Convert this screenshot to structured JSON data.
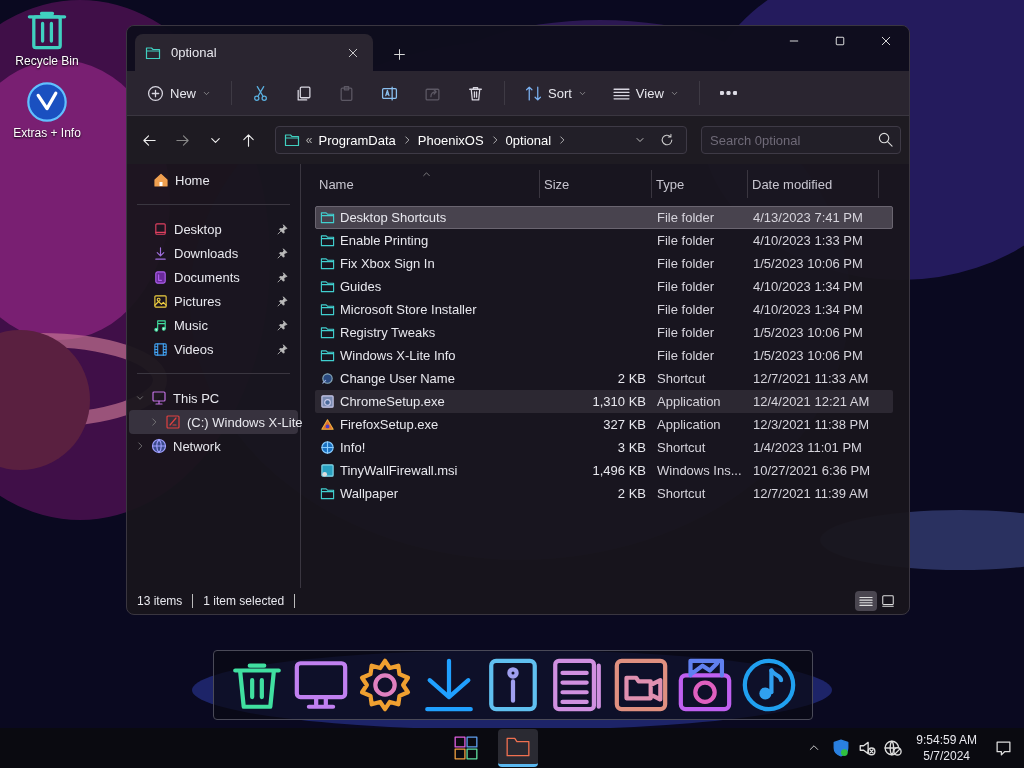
{
  "desktop_icons": [
    {
      "kind": "recycle",
      "label": "Recycle Bin"
    },
    {
      "kind": "orb",
      "label": "Extras + Info"
    }
  ],
  "window": {
    "tab": {
      "title": "0ptional",
      "selected": true
    },
    "toolbar": [
      {
        "kind": "new",
        "label": "New",
        "disabled": false
      },
      {
        "kind": "cut",
        "disabled": false
      },
      {
        "kind": "copy",
        "disabled": false
      },
      {
        "kind": "paste",
        "disabled": true
      },
      {
        "kind": "rename",
        "disabled": false
      },
      {
        "kind": "share",
        "disabled": true
      },
      {
        "kind": "delete",
        "disabled": false
      },
      {
        "kind": "sort",
        "label": "Sort",
        "disabled": false
      },
      {
        "kind": "view",
        "label": "View",
        "disabled": false
      },
      {
        "kind": "more",
        "disabled": false
      }
    ],
    "address": {
      "overflow": "«",
      "path": [
        "ProgramData",
        "PhoenixOS",
        "0ptional"
      ]
    },
    "search": {
      "placeholder": "Search 0ptional"
    },
    "sidebar": {
      "home": {
        "label": "Home"
      },
      "quick_access": [
        {
          "kind": "desktop",
          "label": "Desktop",
          "pinned": true
        },
        {
          "kind": "downloads",
          "label": "Downloads",
          "pinned": true
        },
        {
          "kind": "documents",
          "label": "Documents",
          "pinned": true
        },
        {
          "kind": "pictures",
          "label": "Pictures",
          "pinned": true
        },
        {
          "kind": "music",
          "label": "Music",
          "pinned": true
        },
        {
          "kind": "videos",
          "label": "Videos",
          "pinned": true
        }
      ],
      "tree": [
        {
          "kind": "pc",
          "label": "This PC",
          "expanded": true,
          "selected": false,
          "children": [
            {
              "kind": "drive",
              "label": "(C:) Windows X-Lite",
              "expanded": false,
              "selected": true
            }
          ]
        },
        {
          "kind": "network",
          "label": "Network",
          "expanded": false,
          "selected": false
        }
      ]
    },
    "files": {
      "columns": [
        {
          "label": "Name",
          "sorted": true
        },
        {
          "label": "Size",
          "sorted": false
        },
        {
          "label": "Type",
          "sorted": false
        },
        {
          "label": "Date modified",
          "sorted": false
        }
      ],
      "rows": [
        {
          "kind": "folder",
          "name": "Desktop Shortcuts",
          "size": "",
          "type": "File folder",
          "date": "4/13/2023 7:41 PM",
          "selected": true,
          "hovered": false
        },
        {
          "kind": "folder",
          "name": "Enable Printing",
          "type": "File folder",
          "date": "4/10/2023 1:33 PM",
          "selected": false,
          "hovered": false
        },
        {
          "kind": "folder",
          "name": "Fix Xbox Sign In",
          "type": "File folder",
          "date": "1/5/2023 10:06 PM",
          "selected": false,
          "hovered": false
        },
        {
          "kind": "folder",
          "name": "Guides",
          "type": "File folder",
          "date": "4/10/2023 1:34 PM",
          "selected": false,
          "hovered": false
        },
        {
          "kind": "folder",
          "name": "Microsoft Store Installer",
          "type": "File folder",
          "date": "4/10/2023 1:34 PM",
          "selected": false,
          "hovered": false
        },
        {
          "kind": "folder",
          "name": "Registry Tweaks",
          "type": "File folder",
          "date": "1/5/2023 10:06 PM",
          "selected": false,
          "hovered": false
        },
        {
          "kind": "folder",
          "name": "Windows X-Lite Info",
          "type": "File folder",
          "date": "1/5/2023 10:06 PM",
          "selected": false,
          "hovered": false
        },
        {
          "kind": "shortcut",
          "name": "Change User Name",
          "size": "2 KB",
          "type": "Shortcut",
          "date": "12/7/2021 11:33 AM",
          "selected": false,
          "hovered": false
        },
        {
          "kind": "application",
          "name": "ChromeSetup.exe",
          "size": "1,310 KB",
          "type": "Application",
          "date": "12/4/2021 12:21 AM",
          "selected": false,
          "hovered": true
        },
        {
          "kind": "installer",
          "name": "FirefoxSetup.exe",
          "size": "327 KB",
          "type": "Application",
          "date": "12/3/2021 11:38 PM",
          "selected": false,
          "hovered": false
        },
        {
          "kind": "globe",
          "name": "Info!",
          "size": "3 KB",
          "type": "Shortcut",
          "date": "1/4/2023 11:01 PM",
          "selected": false,
          "hovered": false
        },
        {
          "kind": "msi",
          "name": "TinyWallFirewall.msi",
          "size": "1,496 KB",
          "type": "Windows Ins...",
          "date": "10/27/2021 6:36 PM",
          "selected": false,
          "hovered": false
        },
        {
          "kind": "folder",
          "name": "Wallpaper",
          "size": "2 KB",
          "type": "Shortcut",
          "date": "12/7/2021 11:39 AM",
          "selected": false,
          "hovered": false
        }
      ]
    },
    "status_bar": {
      "count": "13 items",
      "selection": "1 item selected",
      "views": [
        {
          "kind": "details",
          "selected": true
        },
        {
          "kind": "tiles",
          "selected": false
        }
      ]
    }
  },
  "taskbar": {
    "apps": [
      {
        "kind": "start",
        "active": false
      },
      {
        "kind": "explorer",
        "active": true
      }
    ],
    "clock": {
      "time": "9:54:59 AM",
      "date": "5/7/2024"
    }
  }
}
